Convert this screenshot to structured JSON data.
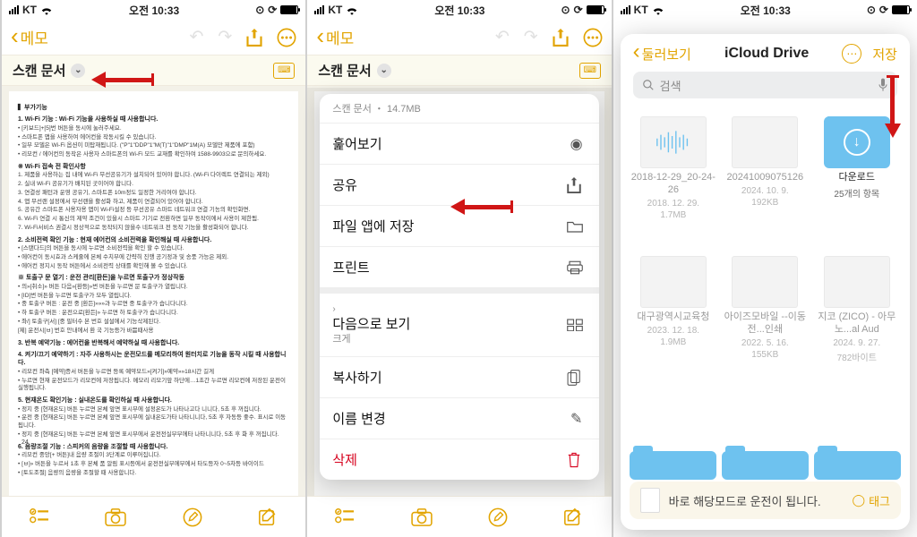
{
  "status": {
    "carrier": "KT",
    "time": "오전 10:33"
  },
  "notes": {
    "back_label": "메모",
    "doc_title": "스캔 문서",
    "page_number": "24",
    "doc_heading": "▍부가기능",
    "sec1_title": "1. Wi-Fi 기능 : Wi-Fi 기능을 사용하실 때 사용합니다.",
    "sec1_l1": "• [키보드]+[5]번 버튼을 동시에 눌러주세요.",
    "sec1_l2": "• 스마트폰 앱을 사용하여 에어컨을 작동시킬 수 있습니다.",
    "sec1_l3": "• 일부 모델은 Wi-Fi 옵션이 미탑재됩니다. (\"P\"1\"DDP\"1\"M(T)\"1\"DMP\"1M(A) 모델만 제품에 포함)",
    "sec1_l4": "• 리모컨 / 에어컨의 동작은 사용자 스마트폰의 Wi-Fi 모드 교재를 확인하여 1588-9903으로 문의하세요.",
    "sec1_sub1": "※ Wi-Fi 접속 전 확인사항",
    "sec1_s1": "1. 제품을 사용하는 집 내에 Wi-Fi 무선공유기가 설치되어 있어야 합니다. (Wi-Fi 다이렉트 연결되는 제외)",
    "sec1_s2": "2. 실내 Wi-Fi 공유기가 배치된 곳이어야 합니다.",
    "sec1_s3": "3. 연결성 패턴과 운영 공유기, 스마트폰 10m정도 일정한 거리여야 합니다.",
    "sec1_s4": "4. 앱 무선랜 설정에서 무선랜을 활성화 하고, 제품이 연결되어 있어야 합니다.",
    "sec1_s5": "5. 공유간 스마트폰 사용자용 앱이 Wi-Fi설정 등 무선공유 스마트 네트워크 연결 기능의 확인화면.",
    "sec1_s6": "6. Wi-Fi 연결 시 통신의 제약 조건이 있을시 스마트 기기로 전환하면 일부 동작이에서 사용이 제한됨.",
    "sec1_s7": "7. Wi-Fi서비스 권결시 정상적으로 동작되지 않을수 네트워크 전 동작 기능을 활성화되어 합니다.",
    "sec2_title": "2. 소비전력 확인 기능 : 현재 에어컨의 소비전력을 확인해실 때 사용합니다.",
    "sec2_l1": "• [스탠다드]의 버튼을 동시에 누르면 소비전력을 확인 할 수 있습니다.",
    "sec2_l2": "• 에어컨이 동시효과 스케줄에 본체 수치부에 간략히 진행 공기정과 및 송풍 가능은 제외.",
    "sec2_l3": "• 에어컨 정지시 동작 버튼에서 소비전력 상태를 확인해 볼 수 있습니다.",
    "sec2_sub1": "※ 토출구 문 열기 : 운전 관리[환든]을 누르면 토출구가 정상작동",
    "sec2_s1": "• 의»[취소]» 버튼 다음»[환등]»번 버튼을 누르면 문 토출구가 열립니다.",
    "sec2_s2": "• [ID]번 버튼을 누르면 토출구가 모두 열립니다.",
    "sec2_s3": "• 중 토출구 버튼 : 운전 중 [환든]»»»과 누르면 중 토출구가 습니다니다.",
    "sec2_s4": "• 하 토출구 버튼 : 운전으로[환든]» 누르면 하 토출구가 습니다니다.",
    "sec2_s5": "• 좌/] 토출구[서] [중 필터수 본 번호 설설에서 기능삭제된다.",
    "sec2_s6": "[제] 운전시[ㅂ] 번호 안내에서 환 국 기능등가 바쁨때사용",
    "sec3_title": "3. 반복 예약기능 : 에어컨을 반복해서 예약하실 때 사용합니다.",
    "sec4_title": "4. 켜기/끄기 예약하기 : 자주 사용하시는 운전모드를 메모리하여 원터치로 기능을 동작 시킬 때 사용합니다.",
    "sec4_l1": "• 리모컨 좌측 [예약]증서 버튼을 누르면 등록 예약모드»[켜기]»예약»»18시간 길게",
    "sec4_l2": "• 누르면 현재 운전모드가 리모컨에 저장됩니다. 메모리 리모기앞 하단에…1초간 누르면 리모컨에 저장된 운전이 실행됩니다.",
    "sec5_title": "5. 현재온도 확인기능 : 실내온도를 확인하실 때 사용합니다.",
    "sec5_l1": "• 정지 중 [현재온도] 버튼 누르면 본체 앞면 표시부에 설정온도가 나타나고다 니니다, 5초 후 꺼집니다.",
    "sec5_l2": "• 운전 중 [현재온도] 버튼 누르면 본체 앞면 표시부에 실내온도가타 나타니니다, 5초 후 자동등 좋수. 표시로 이동됩니다.",
    "sec5_l3": "• 정지 중 [현재온도] 버튼 누르면 본체 앞면 표시부에서 운전전실부부에타 나타니니다, 5초 후 화 후 꺼집니다.",
    "sec6_title": "6. 음량조절 기능 : 스피커의 음량을 조절할 때 사용합니다.",
    "sec6_l1": "• 리모컨 중앙[+ 버튼]내 음량 조절이 3단계로 이루어집니다.",
    "sec6_l2": "• [ㅂ]» 버튼을 누르서 1초 후 본체 품 알림 표시등에서 운전전실부에부에서 타도등자 0~5차등 바이이드",
    "sec6_l3": "• [토도조절] 음량의 음량을 조절할 때 사용합니다. "
  },
  "sheet": {
    "meta": "스캔 문서 ・ 14.7MB",
    "items": {
      "quicklook": "훑어보기",
      "share": "공유",
      "save_to_files": "파일 앱에 저장",
      "print": "프린트",
      "view_as": "다음으로 보기",
      "view_as_sub": "크게",
      "copy": "복사하기",
      "rename": "이름 변경",
      "delete": "삭제"
    }
  },
  "files": {
    "back_label": "둘러보기",
    "title": "iCloud Drive",
    "save_label": "저장",
    "search_placeholder": "검색",
    "banner_text": "바로 해당모드로 운전이 됩니다.",
    "tag_label": "태그",
    "grid": [
      {
        "name": "2018-12-29_20-24-26",
        "date": "2018. 12. 29.",
        "size": "1.7MB",
        "kind": "audio"
      },
      {
        "name": "20241009075126",
        "date": "2024. 10. 9.",
        "size": "192KB",
        "kind": "doc"
      },
      {
        "name": "다운로드",
        "meta2": "25개의 항목",
        "kind": "folder"
      },
      {
        "name": "대구광역시교육청",
        "date": "2023. 12. 18.",
        "size": "1.9MB",
        "kind": "doc"
      },
      {
        "name": "아이즈모바일 --이동전...인쇄",
        "date": "2022. 5. 16.",
        "size": "155KB",
        "kind": "doc"
      },
      {
        "name": "지코 (ZICO) - 아무노...al Aud",
        "date": "2024. 9. 27.",
        "size": "782바이트",
        "kind": "doc"
      }
    ]
  }
}
